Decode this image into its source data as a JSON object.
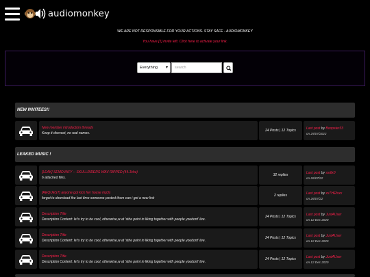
{
  "header": {
    "logo_text": "audiomonkey",
    "disclaimer": "WE ARE NOT RESPONSIBLE FOR YOUR ACTIONS. STAY SAFE - AUDIOMONKEY",
    "invite_note": "You have [1] invite left. Click here to activate your link."
  },
  "search": {
    "scope_selected": "Everything",
    "placeholder": "search",
    "button_icon": "search-icon"
  },
  "sections": [
    {
      "title": "NEW INVITEES!!",
      "topics": [
        {
          "title": "New member introduction threads",
          "description": "Keep it discreet, no real names.",
          "stats": "24 Posts | 12 Topics",
          "last_label": "Last post",
          "last_by": "by",
          "last_user": "Boopster33",
          "last_on": "on 25/07/2022"
        }
      ]
    },
    {
      "title": "LEAKED MUSIC !",
      "topics": [
        {
          "title": "[LEAK] SEMOVAFY -- SKULLRIDERS WAV RIPPED (44.1khz)",
          "description": "6 attached files.",
          "stats": "32 replies",
          "last_label": "Last post",
          "last_by": "by",
          "last_user": "sxdlx0",
          "last_on": "on 26/07/22"
        },
        {
          "title": "[REQUEST] anyone got kick her house mp3s",
          "description": "forgot to download the last time someone posted them can i get a new link",
          "stats": "2 replies",
          "last_label": "Last post",
          "last_by": "by",
          "last_user": "xxTHEfxxx",
          "last_on": "on 26/07/22"
        },
        {
          "title": "Description Title",
          "description": "Description Content: let's try to be cool, otherwise,w at 'sthe point in liking together with people youdont' live.",
          "stats": "24 Posts | 12 Topics",
          "last_label": "Last post",
          "last_by": "by",
          "last_user": "JustAUser",
          "last_on": "on 12 Dec 2020"
        },
        {
          "title": "Description Title",
          "description": "Description Content: let's try to be cool, otherwise,w at 'sthe point in liking together with people youdont' live.",
          "stats": "24 Posts | 12 Topics",
          "last_label": "Last post",
          "last_by": "by",
          "last_user": "JustAUser",
          "last_on": "on 12 Dec 2020"
        },
        {
          "title": "Description Title",
          "description": "Description Content: let's try to be cool, otherwise,w at 'sthe point in liking together with people youdont' live.",
          "stats": "24 Posts | 12 Topics",
          "last_label": "Last post",
          "last_by": "by",
          "last_user": "JustAUser",
          "last_on": "on 12 Dec 2020"
        }
      ]
    }
  ],
  "colors": {
    "accent": "#ff1f4b",
    "panel": "#1a1a1a",
    "section_header": "#2d2d2d",
    "search_border": "#3b1a5c"
  },
  "icons": {
    "menu": "hamburger-menu-icon",
    "logo": "monkey-speaker-logo-icon",
    "topic": "car-icon"
  }
}
